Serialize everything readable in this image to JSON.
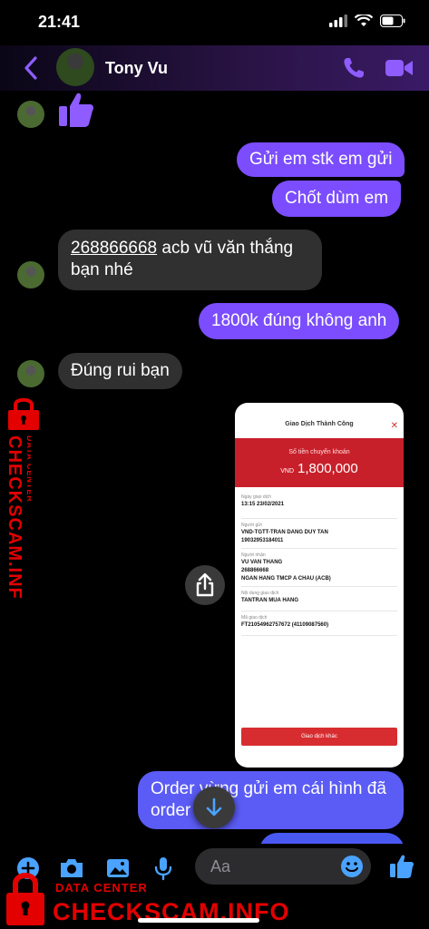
{
  "status": {
    "time": "21:41"
  },
  "header": {
    "contact_name": "Tony Vu"
  },
  "messages": {
    "m1": "Gửi em stk em gửi",
    "m2": "Chốt dùm em",
    "m3_link": "268866668",
    "m3_rest": " acb vũ văn thắng",
    "m3_line2": "bạn nhé",
    "m4": "1800k đúng không anh",
    "m5": "Đúng rui bạn",
    "m6_line1": "Order vừng gửi em cái hình đã",
    "m6_line2": "order"
  },
  "receipt": {
    "title": "Giao Dịch Thành Công",
    "close": "✕",
    "amount_label": "Số tiền chuyển khoản",
    "currency": "VND",
    "amount": "1,800,000",
    "fields": [
      {
        "label": "Ngày giao dịch",
        "value": "13:15 23/02/2021"
      },
      {
        "label": "Người gửi",
        "value": "VND-TGTT-TRAN DANG DUY TAN",
        "value2": "19032953184011"
      },
      {
        "label": "Người nhận",
        "value": "VU VAN THANG",
        "value2": "268866668",
        "value3": "NGAN HANG TMCP A CHAU (ACB)"
      },
      {
        "label": "Nội dung giao dịch",
        "value": "TANTRAN MUA HANG"
      },
      {
        "label": "Mã giao dịch",
        "value": "FT21054962757672 (41109087560)"
      }
    ],
    "button": "Giao dịch khác"
  },
  "composer": {
    "placeholder": "Aa"
  },
  "watermark": {
    "data_center": "DATA CENTER",
    "site": "CHECKSCAM.INFO"
  },
  "colors": {
    "accent": "#7b4dff",
    "incoming": "#303030",
    "watermark": "#e30000"
  }
}
